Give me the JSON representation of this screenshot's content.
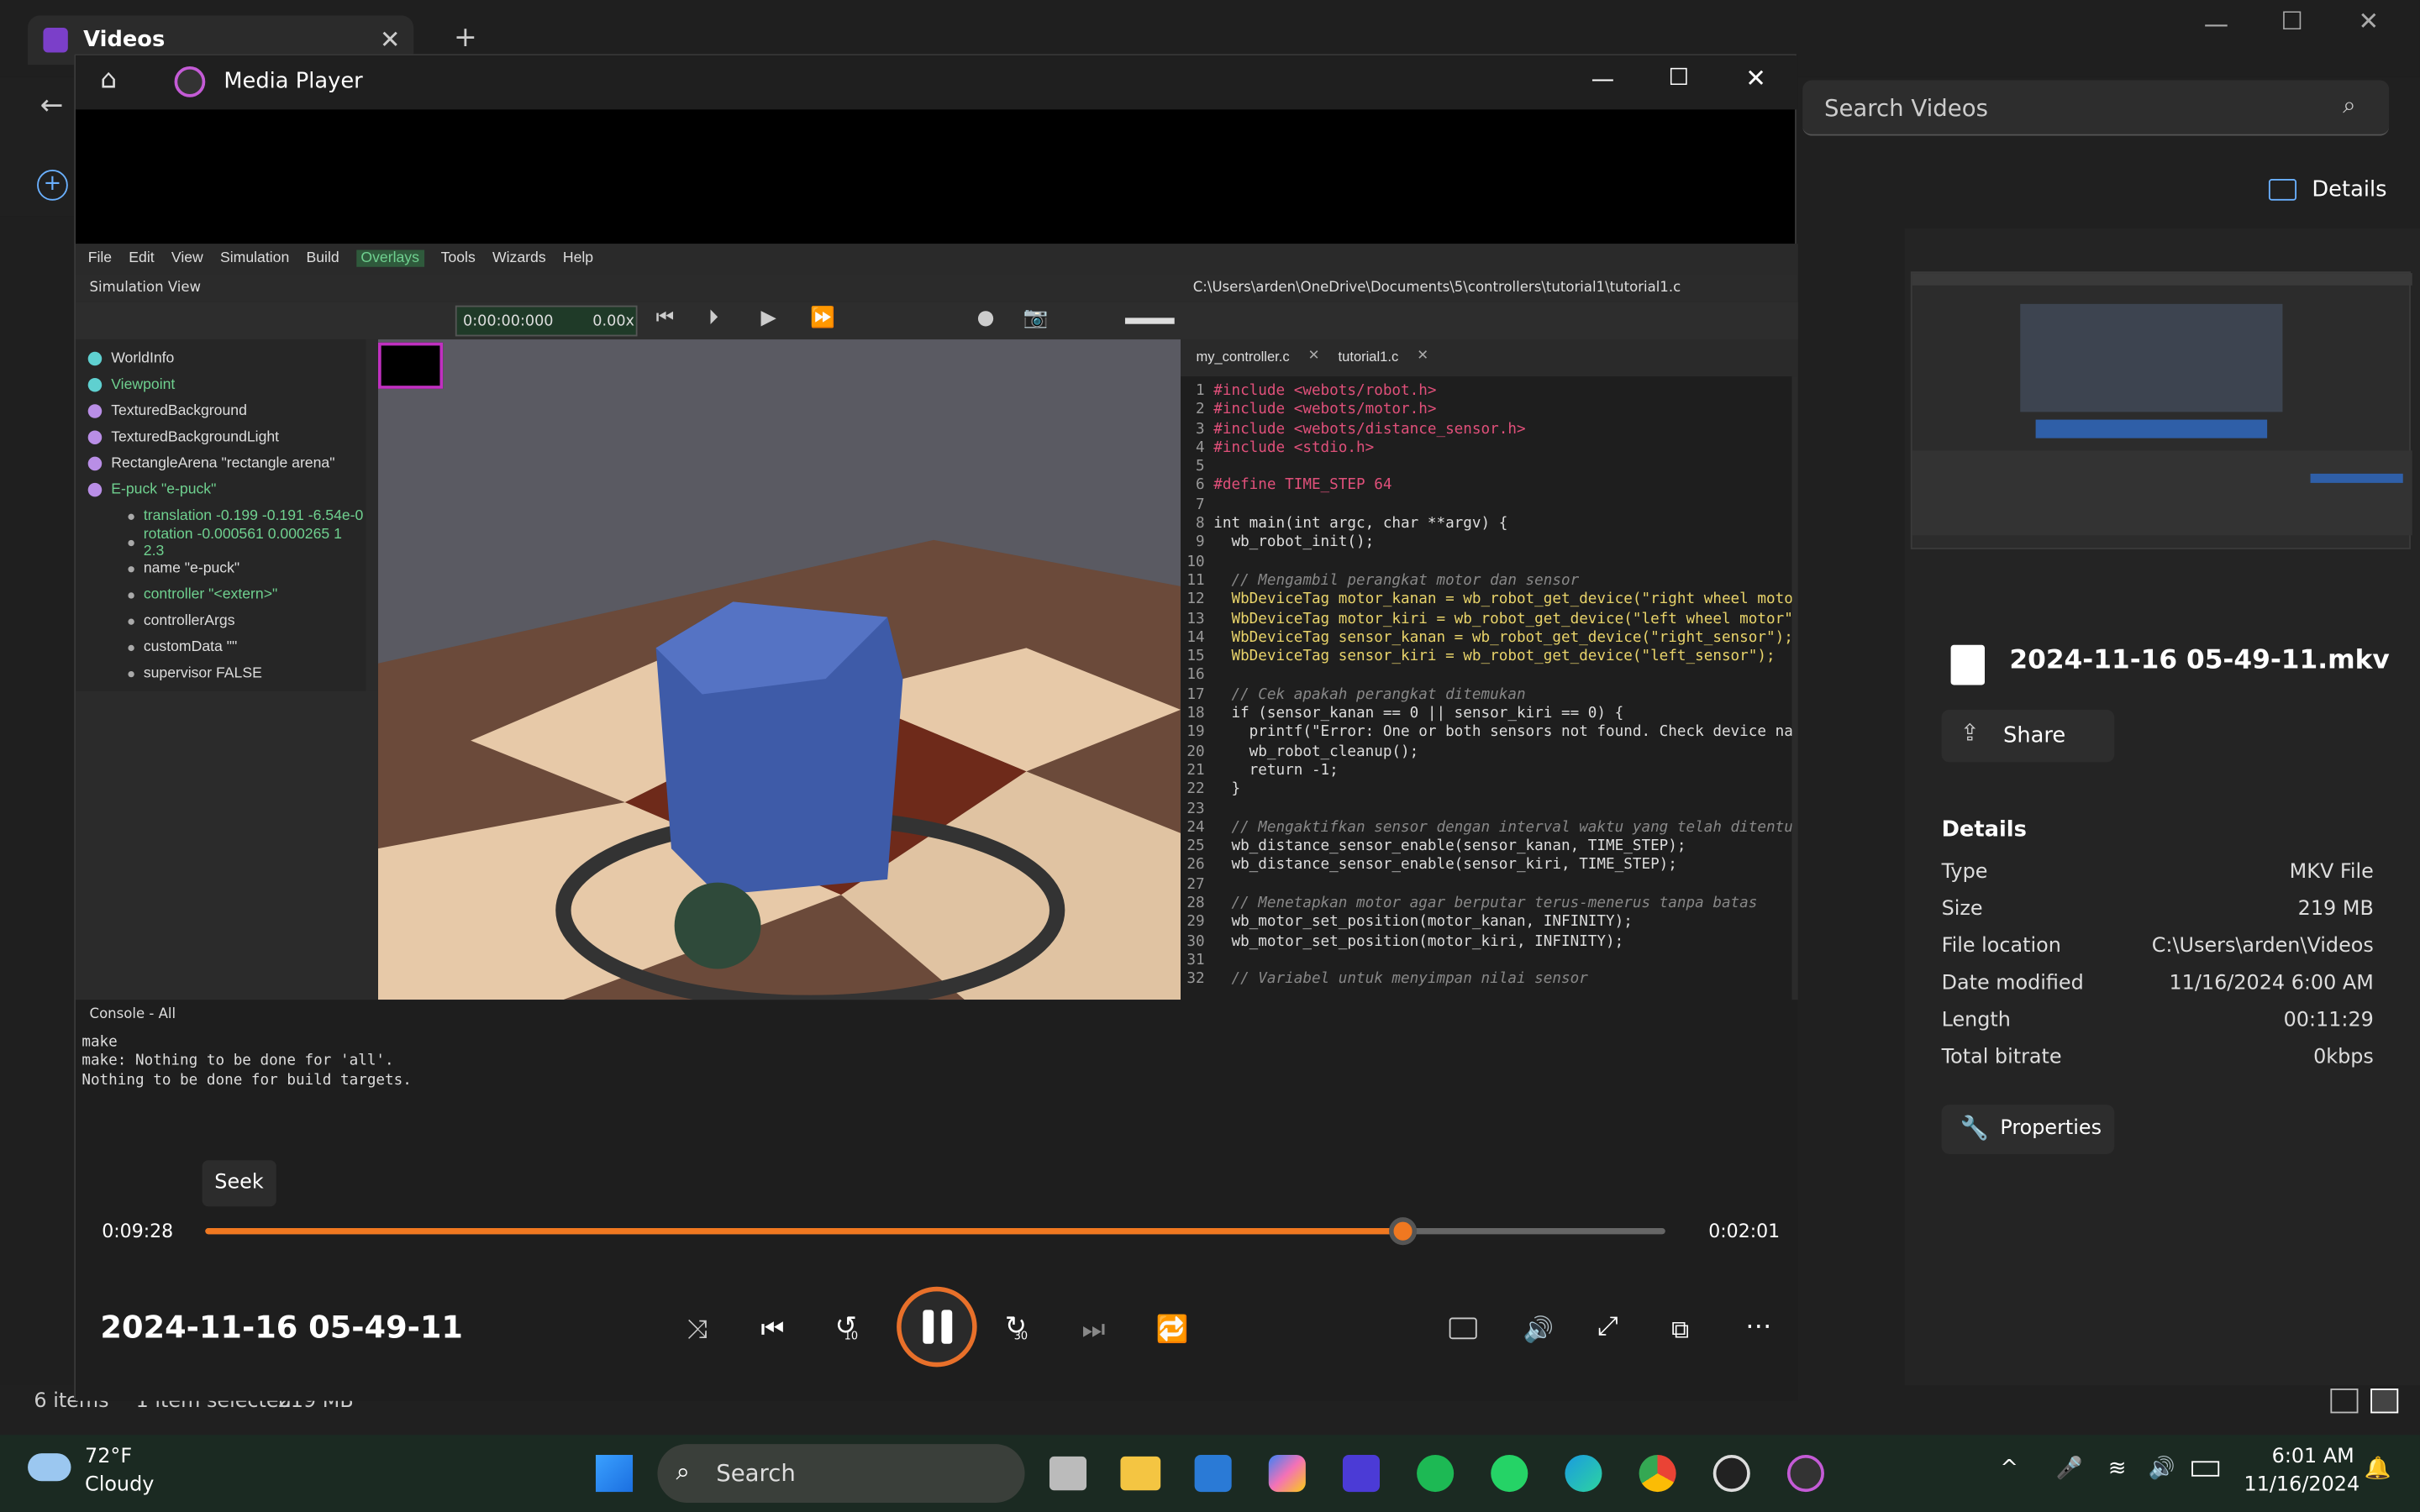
{
  "videos_app": {
    "title": "Videos",
    "search_placeholder": "Search Videos",
    "details_button": "Details",
    "status_items": "6 items",
    "status_selected": "1 item selected",
    "status_size": "219 MB"
  },
  "details": {
    "file_name": "2024-11-16 05-49-11.mkv",
    "share": "Share",
    "heading": "Details",
    "rows": [
      {
        "label": "Type",
        "value": "MKV File"
      },
      {
        "label": "Size",
        "value": "219 MB"
      },
      {
        "label": "File location",
        "value": "C:\\Users\\arden\\Videos"
      },
      {
        "label": "Date modified",
        "value": "11/16/2024 6:00 AM"
      },
      {
        "label": "Length",
        "value": "00:11:29"
      },
      {
        "label": "Total bitrate",
        "value": "0kbps"
      }
    ],
    "properties": "Properties"
  },
  "player": {
    "title": "Media Player",
    "video_title": "2024-11-16 05-49-11",
    "elapsed": "0:09:28",
    "remaining": "0:02:01",
    "seek_tooltip": "Seek",
    "progress": 0.82,
    "skip_back": "10",
    "skip_fwd": "30"
  },
  "webots": {
    "menu": [
      "File",
      "Edit",
      "View",
      "Simulation",
      "Build",
      "Overlays",
      "Tools",
      "Wizards",
      "Help"
    ],
    "sim_view_label": "Simulation View",
    "time": "0:00:00:000",
    "speed": "0.00x",
    "editor_path": "C:\\Users\\arden\\OneDrive\\Documents\\5\\controllers\\tutorial1\\tutorial1.c",
    "tabs": [
      "my_controller.c",
      "tutorial1.c"
    ],
    "console_label": "Console - All",
    "console_lines": [
      "make",
      "make: Nothing to be done for 'all'.",
      "Nothing to be done for build targets."
    ],
    "tree": [
      "WorldInfo",
      "Viewpoint",
      "TexturedBackground",
      "TexturedBackgroundLight",
      "RectangleArena \"rectangle arena\"",
      "E-puck \"e-puck\"",
      "translation -0.199 -0.191 -6.54e-0",
      "rotation -0.000561 0.000265 1 2.3",
      "name \"e-puck\"",
      "controller \"<extern>\"",
      "controllerArgs",
      "customData \"\"",
      "supervisor FALSE"
    ],
    "code": [
      "#include <webots/robot.h>",
      "#include <webots/motor.h>",
      "#include <webots/distance_sensor.h>",
      "#include <stdio.h>",
      "",
      "#define TIME_STEP 64",
      "",
      "int main(int argc, char **argv) {",
      "  wb_robot_init();",
      "",
      "  // Mengambil perangkat motor dan sensor",
      "  WbDeviceTag motor_kanan = wb_robot_get_device(\"right wheel motor\"",
      "  WbDeviceTag motor_kiri = wb_robot_get_device(\"left wheel motor\");",
      "  WbDeviceTag sensor_kanan = wb_robot_get_device(\"right_sensor\");",
      "  WbDeviceTag sensor_kiri = wb_robot_get_device(\"left_sensor\");",
      "",
      "  // Cek apakah perangkat ditemukan",
      "  if (sensor_kanan == 0 || sensor_kiri == 0) {",
      "    printf(\"Error: One or both sensors not found. Check device names",
      "    wb_robot_cleanup();",
      "    return -1;",
      "  }",
      "",
      "  // Mengaktifkan sensor dengan interval waktu yang telah ditentukan",
      "  wb_distance_sensor_enable(sensor_kanan, TIME_STEP);",
      "  wb_distance_sensor_enable(sensor_kiri, TIME_STEP);",
      "",
      "  // Menetapkan motor agar berputar terus-menerus tanpa batas",
      "  wb_motor_set_position(motor_kanan, INFINITY);",
      "  wb_motor_set_position(motor_kiri, INFINITY);",
      "",
      "  // Variabel untuk menyimpan nilai sensor"
    ]
  },
  "taskbar": {
    "temp": "72°F",
    "weather": "Cloudy",
    "search": "Search",
    "time": "6:01 AM",
    "date": "11/16/2024"
  }
}
